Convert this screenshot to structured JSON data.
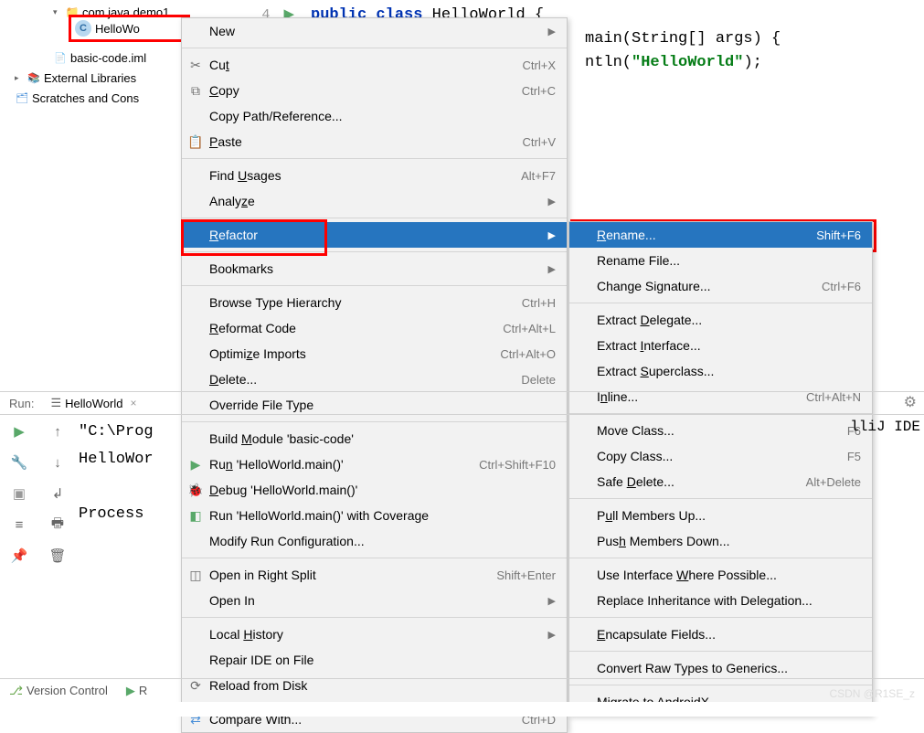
{
  "tree": {
    "pkg": "com.java.demo1",
    "file": "HelloWo",
    "iml": "basic-code.iml",
    "ext_libs": "External Libraries",
    "scratches": "Scratches and Cons"
  },
  "editor": {
    "gutter_num": "4",
    "line1_kw": "public class",
    "line1_rest": " HelloWorld {",
    "line2_pre": "main(String[] args) {",
    "line3_pre": "ntln(",
    "line3_str": "\"HelloWorld\"",
    "line3_post": ");"
  },
  "menu1": {
    "new": "New",
    "cut": "Cut",
    "cut_k": "Ctrl+X",
    "copy": "Copy",
    "copy_k": "Ctrl+C",
    "copy_path": "Copy Path/Reference...",
    "paste": "Paste",
    "paste_k": "Ctrl+V",
    "find_usages": "Find Usages",
    "find_usages_k": "Alt+F7",
    "analyze": "Analyze",
    "refactor": "Refactor",
    "bookmarks": "Bookmarks",
    "browse_hier": "Browse Type Hierarchy",
    "browse_hier_k": "Ctrl+H",
    "reformat": "Reformat Code",
    "reformat_k": "Ctrl+Alt+L",
    "opt_imp": "Optimize Imports",
    "opt_imp_k": "Ctrl+Alt+O",
    "delete": "Delete...",
    "delete_k": "Delete",
    "override_ft": "Override File Type",
    "build_mod": "Build Module 'basic-code'",
    "run": "Run 'HelloWorld.main()'",
    "run_k": "Ctrl+Shift+F10",
    "debug": "Debug 'HelloWorld.main()'",
    "coverage": "Run 'HelloWorld.main()' with Coverage",
    "modify_run": "Modify Run Configuration...",
    "open_split": "Open in Right Split",
    "open_split_k": "Shift+Enter",
    "open_in": "Open In",
    "local_hist": "Local History",
    "repair_ide": "Repair IDE on File",
    "reload": "Reload from Disk",
    "compare": "Compare With...",
    "compare_k": "Ctrl+D"
  },
  "menu2": {
    "rename": "Rename...",
    "rename_k": "Shift+F6",
    "rename_file": "Rename File...",
    "change_sig": "Change Signature...",
    "change_sig_k": "Ctrl+F6",
    "ext_delegate": "Extract Delegate...",
    "ext_interface": "Extract Interface...",
    "ext_super": "Extract Superclass...",
    "inline": "Inline...",
    "inline_k": "Ctrl+Alt+N",
    "move_class": "Move Class...",
    "move_class_k": "F6",
    "copy_class": "Copy Class...",
    "copy_class_k": "F5",
    "safe_delete": "Safe Delete...",
    "safe_delete_k": "Alt+Delete",
    "pull_up": "Pull Members Up...",
    "push_down": "Push Members Down...",
    "use_iface": "Use Interface Where Possible...",
    "replace_inh": "Replace Inheritance with Delegation...",
    "encaps": "Encapsulate Fields...",
    "convert_raw": "Convert Raw Types to Generics...",
    "migrate_ax": "Migrate to AndroidX..."
  },
  "run_panel": {
    "label": "Run:",
    "tab": "HelloWorld",
    "path": "\"C:\\Prog",
    "hello": "HelloWor",
    "process": "Process ",
    "right": "lliJ IDE"
  },
  "bottom": {
    "vc": "Version Control",
    "r": "R"
  },
  "status": {
    "hint": "",
    "pos": "",
    "watermark": "CSDN @R1SE_z"
  }
}
